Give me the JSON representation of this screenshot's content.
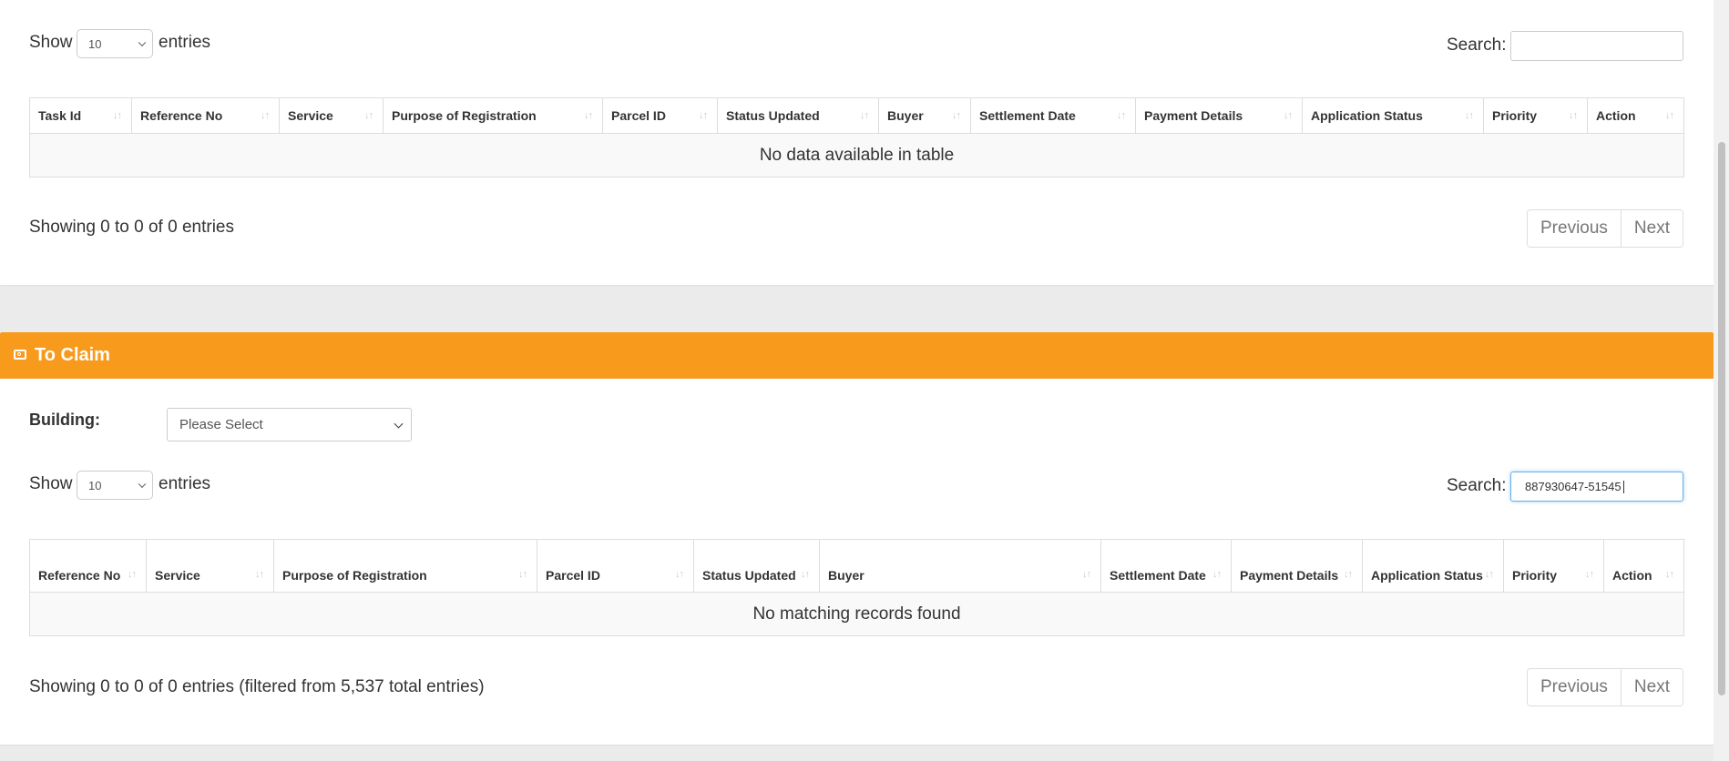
{
  "top_section": {
    "show_label": "Show",
    "length_value": "10",
    "entries_label": "entries",
    "search_label": "Search:",
    "search_value": "",
    "columns": [
      "Task Id",
      "Reference No",
      "Service",
      "Purpose of Registration",
      "Parcel ID",
      "Status Updated",
      "Buyer",
      "Settlement Date",
      "Payment Details",
      "Application Status",
      "Priority",
      "Action"
    ],
    "empty_message": "No data available in table",
    "info": "Showing 0 to 0 of 0 entries",
    "pagination": {
      "previous": "Previous",
      "next": "Next"
    }
  },
  "claim_section": {
    "title": "To Claim",
    "icon": "camera-icon",
    "accent_color": "#f89a1b",
    "building_label": "Building:",
    "building_value": "Please Select",
    "show_label": "Show",
    "length_value": "10",
    "entries_label": "entries",
    "search_label": "Search:",
    "search_value": "887930647-51545",
    "columns": [
      "Reference No",
      "Service",
      "Purpose of Registration",
      "Parcel ID",
      "Status Updated",
      "Buyer",
      "Settlement Date",
      "Payment Details",
      "Application Status",
      "Priority",
      "Action"
    ],
    "empty_message": "No matching records found",
    "info": "Showing 0 to 0 of 0 entries (filtered from 5,537 total entries)",
    "pagination": {
      "previous": "Previous",
      "next": "Next"
    }
  }
}
